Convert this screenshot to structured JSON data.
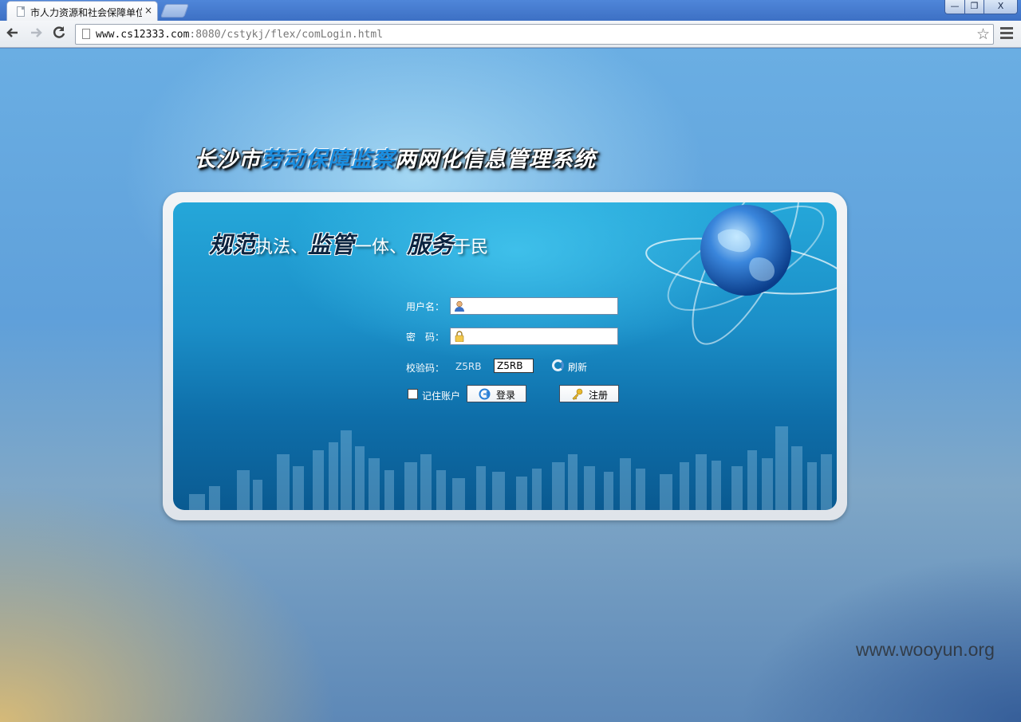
{
  "browser": {
    "tab_title": "市人力资源和社会保障单位",
    "tab_close": "×",
    "url_host": "www.cs12333.com",
    "url_rest": ":8080/cstykj/flex/comLogin.html",
    "window_buttons": {
      "minimize": "—",
      "maximize": "❐",
      "close": "X"
    }
  },
  "page": {
    "system_title_part1": "长沙市",
    "system_title_highlight": "劳动保障监察",
    "system_title_part2": "两网化信息管理系统",
    "slogan": {
      "w1": "规范",
      "t1": "执法、",
      "w2": "监管",
      "t2": "一体、",
      "w3": "服务",
      "t3": "于民"
    },
    "form": {
      "username_label": "用户名：",
      "username_value": "",
      "password_label": "密　码：",
      "password_value": "",
      "captcha_label": "校验码：",
      "captcha_image_text": "Z5RB",
      "captcha_value": "Z5RB",
      "refresh_label": "刷新",
      "remember_label": "记住账户",
      "login_button": "登录",
      "register_button": "注册"
    }
  },
  "watermark": "www.wooyun.org",
  "colors": {
    "titlebar": "#3d70c4",
    "card_blue": "#1b8fc8",
    "title_highlight": "#1a8ee0"
  }
}
